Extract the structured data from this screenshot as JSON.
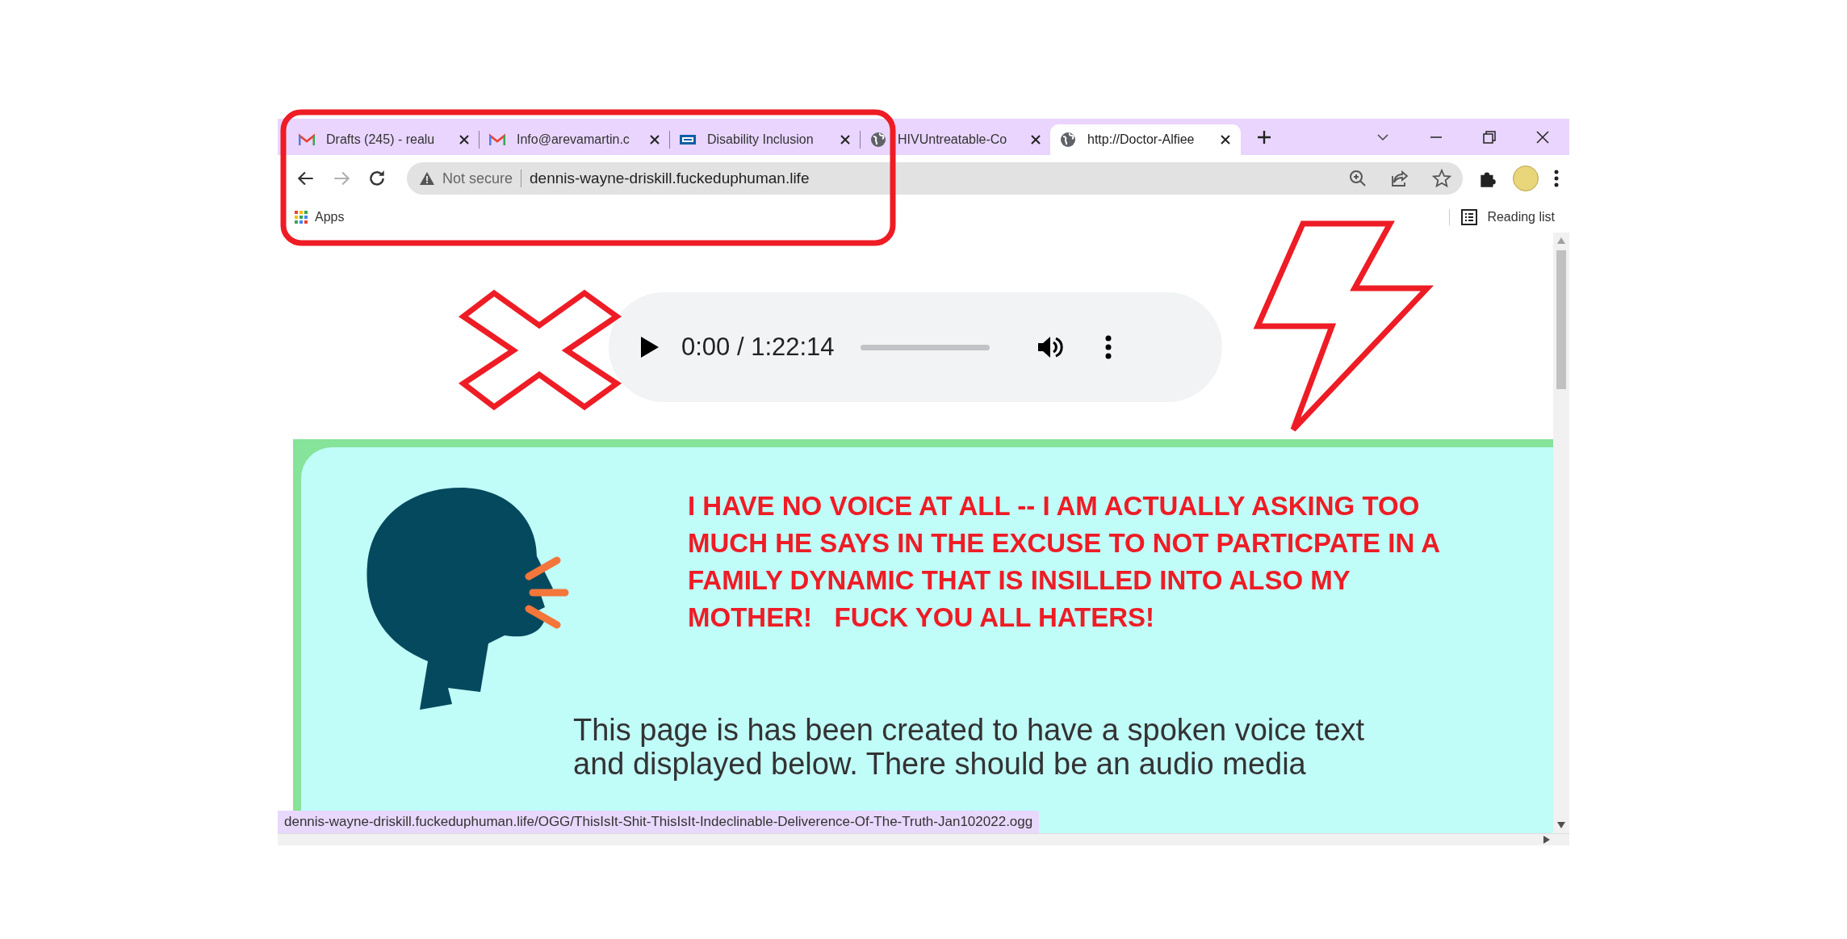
{
  "tabs": [
    {
      "title": "Drafts (245) - realu",
      "kind": "mail",
      "selected": false
    },
    {
      "title": "Info@arevamartin.c",
      "kind": "mail",
      "selected": false
    },
    {
      "title": "Disability Inclusion",
      "kind": "agency",
      "selected": false
    },
    {
      "title": "HIVUntreatable-Co",
      "kind": "web",
      "selected": false
    },
    {
      "title": "http://Doctor-Alfiee",
      "kind": "web",
      "selected": true
    }
  ],
  "toolbar": {
    "forward_disabled": true,
    "security_label": "Not secure",
    "url": "dennis-wayne-driskill.fuckeduphuman.life"
  },
  "bookmarks": [
    {
      "label": "Apps"
    }
  ],
  "reading_list": {
    "label": "Reading list"
  },
  "audio_player": {
    "time": "0:00 / 1:22:14",
    "level": 0
  },
  "panel": {
    "heading_lines": [
      "I HAVE NO VOICE AT ALL -- I AM ACTUALLY ASKING TOO",
      "MUCH HE SAYS IN THE EXCUSE TO NOT PARTICPATE IN A",
      "FAMILY DYNAMIC THAT IS INSILLED INTO ALSO MY",
      "MOTHER!   FUCK YOU ALL HATERS!"
    ],
    "paragraph_lines": [
      "This page is has been created to have a spoken voice text",
      "and displayed below. There should be an audio media"
    ]
  },
  "status_bar": {
    "url": "dennis-wayne-driskill.fuckeduphuman.life/OGG/ThisIsIt-Shit-ThisIsIt-Indeclinable-Deliverence-Of-The-Truth-Jan102022.ogg"
  }
}
